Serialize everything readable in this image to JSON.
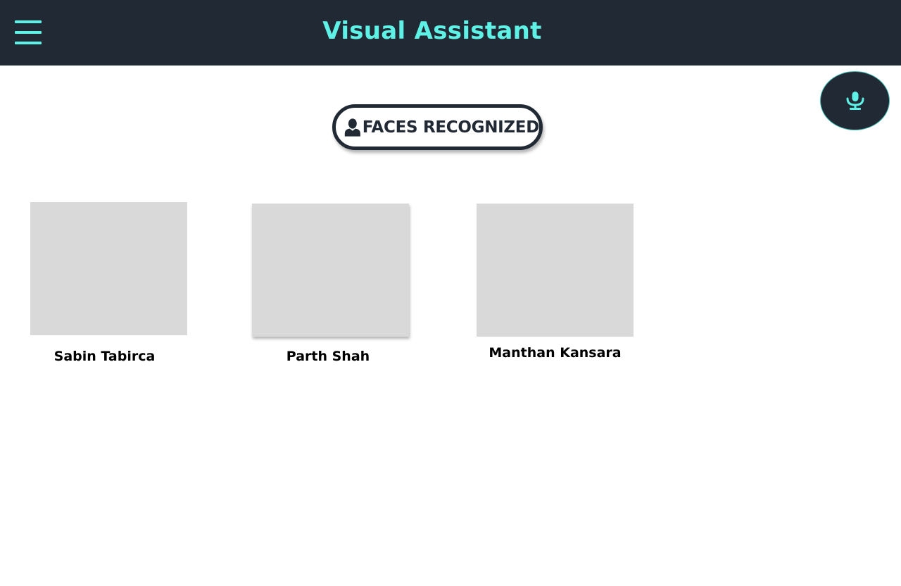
{
  "header": {
    "title": "Visual Assistant",
    "menu_icon": "hamburger-menu-icon"
  },
  "voice": {
    "icon": "microphone-icon"
  },
  "faces_button": {
    "icon": "person-icon",
    "label": "FACES RECOGNIZED"
  },
  "faces": [
    {
      "name": "Sabin Tabirca"
    },
    {
      "name": "Parth Shah"
    },
    {
      "name": "Manthan Kansara"
    }
  ],
  "colors": {
    "header_bg": "#212934",
    "accent": "#5ef2e6",
    "photo_placeholder": "#d9d9d9"
  }
}
